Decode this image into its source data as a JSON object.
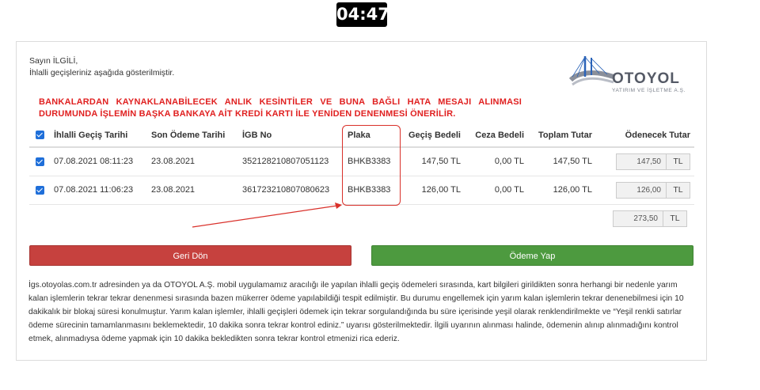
{
  "timer": "04:47",
  "greeting": {
    "line1": "Sayın İLGİLİ,",
    "line2": "İhlalli geçişleriniz aşağıda gösterilmiştir."
  },
  "logo": {
    "name": "OTOYOL",
    "subtitle": "YATIRIM VE İŞLETME A.Ş."
  },
  "warning": {
    "line1": "BANKALARDAN KAYNAKLANABİLECEK ANLIK KESİNTİLER VE BUNA BAĞLI HATA MESAJI ALINMASI",
    "line2": "DURUMUNDA İŞLEMİN BAŞKA BANKAYA AİT KREDİ KARTI İLE YENİDEN DENENMESİ ÖNERİLİR."
  },
  "table": {
    "headers": {
      "date": "İhlalli Geçiş Tarihi",
      "last_payment": "Son Ödeme Tarihi",
      "igb": "İGB No",
      "plate": "Plaka",
      "fee": "Geçiş Bedeli",
      "penalty": "Ceza Bedeli",
      "total": "Toplam Tutar",
      "payable": "Ödenecek Tutar"
    },
    "rows": [
      {
        "checked": true,
        "date": "07.08.2021 08:11:23",
        "last_payment": "23.08.2021",
        "igb": "352128210807051123",
        "plate": "BHKB3383",
        "fee": "147,50 TL",
        "penalty": "0,00 TL",
        "total": "147,50 TL",
        "payable": "147,50",
        "currency": "TL"
      },
      {
        "checked": true,
        "date": "07.08.2021 11:06:23",
        "last_payment": "23.08.2021",
        "igb": "361723210807080623",
        "plate": "BHKB3383",
        "fee": "126,00 TL",
        "penalty": "0,00 TL",
        "total": "126,00 TL",
        "payable": "126,00",
        "currency": "TL"
      }
    ],
    "grand_total": "273,50",
    "grand_total_currency": "TL"
  },
  "buttons": {
    "back": "Geri Dön",
    "pay": "Ödeme Yap"
  },
  "info_text": "İgs.otoyolas.com.tr adresinden ya da OTOYOL A.Ş. mobil uygulamamız aracılığı ile yapılan ihlalli geçiş ödemeleri sırasında, kart bilgileri girildikten sonra herhangi bir nedenle yarım kalan işlemlerin tekrar tekrar denenmesi sırasında bazen mükerrer ödeme yapılabildiği tespit edilmiştir. Bu durumu engellemek için yarım kalan işlemlerin tekrar denenebilmesi için 10 dakikalık bir blokaj süresi konulmuştur. Yarım kalan işlemler, ihlalli geçişleri ödemek için tekrar sorgulandığında bu süre içerisinde yeşil olarak renklendirilmekte ve “Yeşil renkli satırlar ödeme sürecinin tamamlanmasını beklemektedir, 10 dakika sonra tekrar kontrol ediniz.” uyarısı gösterilmektedir. İlgili uyarının alınması halinde, ödemenin alınıp alınmadığını kontrol etmek, alınmadıysa ödeme yapmak için 10 dakika bekledikten sonra tekrar kontrol etmenizi rica ederiz.",
  "colors": {
    "warning": "#e02020",
    "back_button": "#c6413e",
    "pay_button": "#4d9a3f",
    "checkbox": "#1f6fd9",
    "highlight": "#d9302a"
  }
}
